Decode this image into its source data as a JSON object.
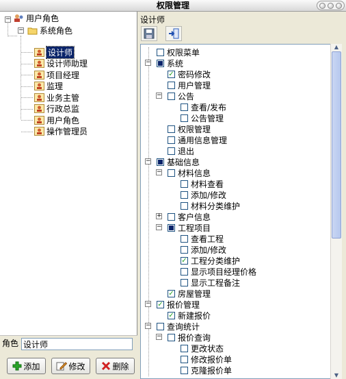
{
  "window": {
    "title": "权限管理"
  },
  "left": {
    "root": {
      "label": "用户角色"
    },
    "folder": {
      "label": "系统角色"
    },
    "roles": [
      {
        "label": "设计师",
        "selected": true
      },
      {
        "label": "设计师助理"
      },
      {
        "label": "项目经理"
      },
      {
        "label": "监理"
      },
      {
        "label": "业务主管"
      },
      {
        "label": "行政总监"
      },
      {
        "label": "用户角色"
      },
      {
        "label": "操作管理员"
      }
    ],
    "role_label": "角色",
    "role_value": "设计师",
    "buttons": {
      "add": "添加",
      "edit": "修改",
      "delete": "删除"
    }
  },
  "right": {
    "header": "设计师",
    "tools": {
      "save_icon": "save-icon",
      "import_icon": "import-icon"
    },
    "tree": [
      {
        "label": "权限菜单",
        "check": "none"
      },
      {
        "label": "系统",
        "check": "partial",
        "exp": "-"
      },
      {
        "label": "密码修改",
        "check": "checked"
      },
      {
        "label": "用户管理",
        "check": "none"
      },
      {
        "label": "公告",
        "check": "none",
        "exp": "-"
      },
      {
        "label": "查看/发布",
        "check": "none"
      },
      {
        "label": "公告管理",
        "check": "none"
      },
      {
        "label": "权限管理",
        "check": "none"
      },
      {
        "label": "通用信息管理",
        "check": "none"
      },
      {
        "label": "退出",
        "check": "none"
      },
      {
        "label": "基础信息",
        "check": "partial",
        "exp": "-"
      },
      {
        "label": "材料信息",
        "check": "none",
        "exp": "-"
      },
      {
        "label": "材料查看",
        "check": "none"
      },
      {
        "label": "添加/修改",
        "check": "none"
      },
      {
        "label": "材料分类维护",
        "check": "none"
      },
      {
        "label": "客户信息",
        "check": "none",
        "exp": "+"
      },
      {
        "label": "工程项目",
        "check": "partial",
        "exp": "-"
      },
      {
        "label": "查看工程",
        "check": "none"
      },
      {
        "label": "添加/修改",
        "check": "none"
      },
      {
        "label": "工程分类维护",
        "check": "checked"
      },
      {
        "label": "显示项目经理价格",
        "check": "none"
      },
      {
        "label": "显示工程备注",
        "check": "none"
      },
      {
        "label": "房屋管理",
        "check": "checked"
      },
      {
        "label": "报价管理",
        "check": "checked",
        "exp": "-"
      },
      {
        "label": "新建报价",
        "check": "checked"
      },
      {
        "label": "查询统计",
        "check": "none",
        "exp": "-"
      },
      {
        "label": "报价查询",
        "check": "none",
        "exp": "-"
      },
      {
        "label": "更改状态",
        "check": "none"
      },
      {
        "label": "修改报价单",
        "check": "none"
      },
      {
        "label": "克隆报价单",
        "check": "none"
      }
    ]
  }
}
